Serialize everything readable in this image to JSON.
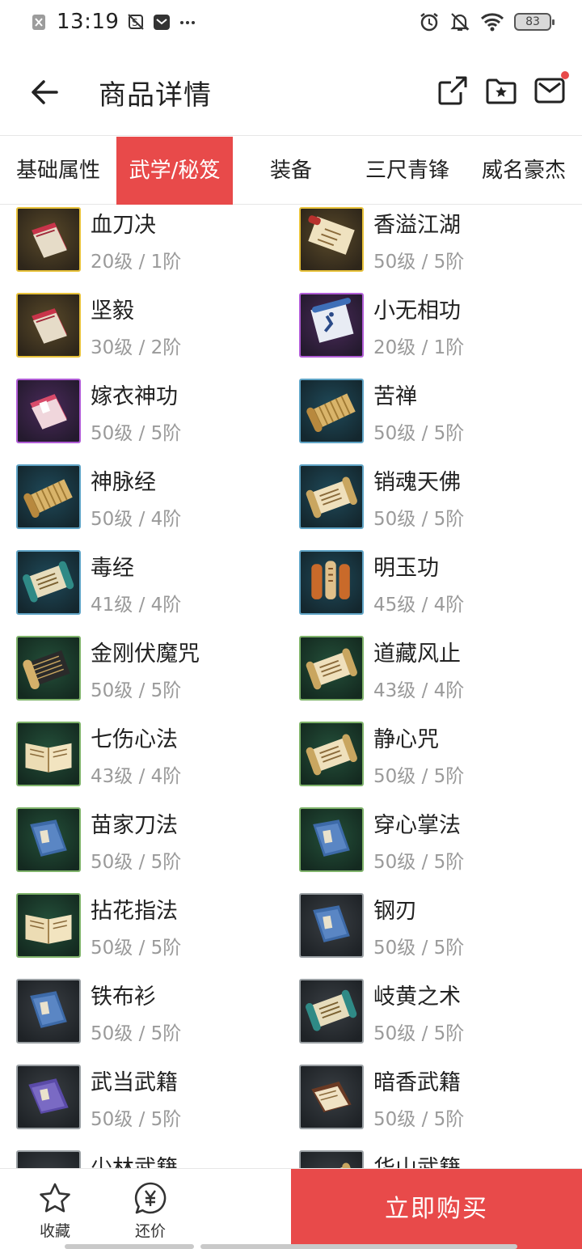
{
  "status_bar": {
    "time": "13:19",
    "battery": "83",
    "left_icons": [
      "close-box-icon",
      "no-sync-icon",
      "mail-app-icon",
      "more-dots-icon"
    ],
    "right_icons": [
      "alarm-icon",
      "bell-off-icon",
      "wifi-icon",
      "battery-icon"
    ]
  },
  "header": {
    "title": "商品详情",
    "actions": [
      "share-icon",
      "favorite-folder-icon",
      "message-icon"
    ],
    "has_notification": true
  },
  "tabs": [
    {
      "label": "基础属性",
      "active": false
    },
    {
      "label": "武学/秘笈",
      "active": true
    },
    {
      "label": "装备",
      "active": false
    },
    {
      "label": "三尺青锋",
      "active": false
    },
    {
      "label": "威名豪杰",
      "active": false
    }
  ],
  "items": [
    {
      "name": "血刀决",
      "meta": "20级 / 1阶",
      "frame": "gold",
      "icon": "red-book"
    },
    {
      "name": "香溢江湖",
      "meta": "50级 / 5阶",
      "frame": "gold",
      "icon": "red-scroll"
    },
    {
      "name": "坚毅",
      "meta": "30级 / 2阶",
      "frame": "gold",
      "icon": "red-book"
    },
    {
      "name": "小无相功",
      "meta": "20级 / 1阶",
      "frame": "purple",
      "icon": "blue-scroll"
    },
    {
      "name": "嫁衣神功",
      "meta": "50级 / 5阶",
      "frame": "purple",
      "icon": "pink-book"
    },
    {
      "name": "苦禅",
      "meta": "50级 / 5阶",
      "frame": "blue",
      "icon": "bamboo-scroll"
    },
    {
      "name": "神脉经",
      "meta": "50级 / 4阶",
      "frame": "blue",
      "icon": "bamboo-scroll"
    },
    {
      "name": "销魂天佛",
      "meta": "50级 / 5阶",
      "frame": "blue",
      "icon": "paper-scroll"
    },
    {
      "name": "毒经",
      "meta": "41级 / 4阶",
      "frame": "blue",
      "icon": "teal-scroll"
    },
    {
      "name": "明玉功",
      "meta": "45级 / 4阶",
      "frame": "blue",
      "icon": "orange-scroll"
    },
    {
      "name": "金刚伏魔咒",
      "meta": "50级 / 5阶",
      "frame": "green",
      "icon": "dark-scroll"
    },
    {
      "name": "道藏风止",
      "meta": "43级 / 4阶",
      "frame": "green",
      "icon": "paper-scroll"
    },
    {
      "name": "七伤心法",
      "meta": "43级 / 4阶",
      "frame": "green",
      "icon": "open-book"
    },
    {
      "name": "静心咒",
      "meta": "50级 / 5阶",
      "frame": "green",
      "icon": "paper-scroll"
    },
    {
      "name": "苗家刀法",
      "meta": "50级 / 5阶",
      "frame": "green",
      "icon": "blue-book"
    },
    {
      "name": "穿心掌法",
      "meta": "50级 / 5阶",
      "frame": "green",
      "icon": "blue-book"
    },
    {
      "name": "拈花指法",
      "meta": "50级 / 5阶",
      "frame": "green",
      "icon": "open-book"
    },
    {
      "name": "钢刃",
      "meta": "50级 / 5阶",
      "frame": "gray",
      "icon": "blue-book"
    },
    {
      "name": "铁布衫",
      "meta": "50级 / 5阶",
      "frame": "gray",
      "icon": "blue-book"
    },
    {
      "name": "岐黄之术",
      "meta": "50级 / 5阶",
      "frame": "gray",
      "icon": "teal-scroll"
    },
    {
      "name": "武当武籍",
      "meta": "50级 / 5阶",
      "frame": "gray",
      "icon": "purple-book"
    },
    {
      "name": "暗香武籍",
      "meta": "50级 / 5阶",
      "frame": "gray",
      "icon": "brown-book"
    },
    {
      "name": "少林武籍",
      "meta": "",
      "frame": "gray",
      "icon": "open-book"
    },
    {
      "name": "华山武籍",
      "meta": "",
      "frame": "gray",
      "icon": "paper-scroll"
    }
  ],
  "bottom_bar": {
    "favorite_label": "收藏",
    "bargain_label": "还价",
    "buy_label": "立即购买"
  },
  "colors": {
    "accent": "#e84a4a",
    "frame_gold": "#e8c23a",
    "frame_purple": "#b05cd6",
    "frame_blue": "#5fa4c6",
    "frame_green": "#7fb36a",
    "frame_gray": "#9aa0a4"
  }
}
